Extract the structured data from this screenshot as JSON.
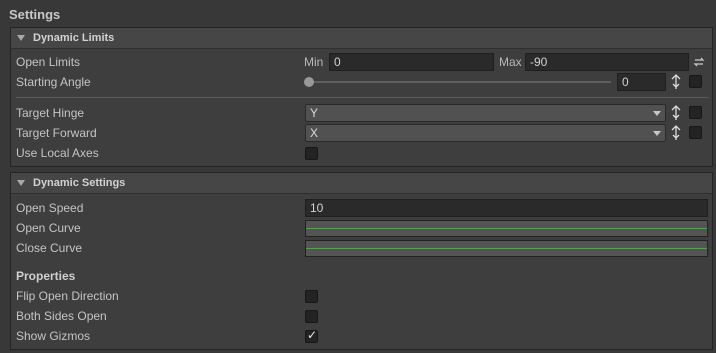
{
  "window": {
    "title": "Settings"
  },
  "dynamic_limits": {
    "header": "Dynamic Limits",
    "open_limits": {
      "label": "Open Limits",
      "min_label": "Min",
      "min_value": "0",
      "max_label": "Max",
      "max_value": "-90"
    },
    "starting_angle": {
      "label": "Starting Angle",
      "value": "0",
      "slider_fraction": 0
    },
    "target_hinge": {
      "label": "Target Hinge",
      "value": "Y"
    },
    "target_forward": {
      "label": "Target Forward",
      "value": "X"
    },
    "use_local_axes": {
      "label": "Use Local Axes",
      "checked": false
    }
  },
  "dynamic_settings": {
    "header": "Dynamic Settings",
    "open_speed": {
      "label": "Open Speed",
      "value": "10"
    },
    "open_curve": {
      "label": "Open Curve"
    },
    "close_curve": {
      "label": "Close Curve"
    },
    "properties_header": "Properties",
    "flip_open_direction": {
      "label": "Flip Open Direction",
      "checked": false
    },
    "both_sides_open": {
      "label": "Both Sides Open",
      "checked": false
    },
    "show_gizmos": {
      "label": "Show Gizmos",
      "checked": true
    }
  },
  "colors": {
    "curve_line": "#2fbb2f",
    "panel_bg": "#3e3e3e",
    "field_bg": "#2a2a2a"
  },
  "icons": {
    "swap": "swap-icon",
    "pin": "pin-icon",
    "checkmark": "✓"
  }
}
